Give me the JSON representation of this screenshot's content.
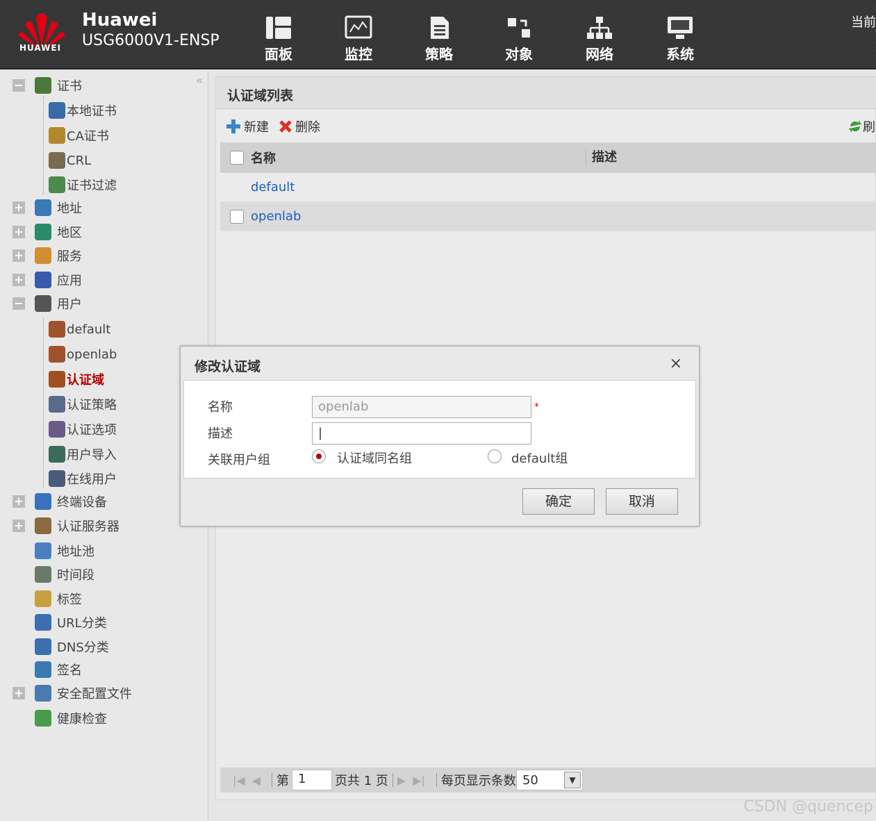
{
  "header": {
    "brand_line1": "Huawei",
    "brand_line2": "USG6000V1-ENSP",
    "logo_text": "HUAWEI",
    "current_label": "当前",
    "nav": [
      {
        "label": "面板",
        "icon": "dashboard-icon"
      },
      {
        "label": "监控",
        "icon": "monitor-icon"
      },
      {
        "label": "策略",
        "icon": "policy-icon"
      },
      {
        "label": "对象",
        "icon": "object-icon"
      },
      {
        "label": "网络",
        "icon": "network-icon"
      },
      {
        "label": "系统",
        "icon": "system-icon"
      }
    ]
  },
  "sidebar": {
    "collapse_icon": "«",
    "items": [
      {
        "label": "证书",
        "expander": "−"
      },
      {
        "label": "本地证书"
      },
      {
        "label": "CA证书"
      },
      {
        "label": "CRL"
      },
      {
        "label": "证书过滤"
      },
      {
        "label": "地址",
        "expander": "+"
      },
      {
        "label": "地区",
        "expander": "+"
      },
      {
        "label": "服务",
        "expander": "+"
      },
      {
        "label": "应用",
        "expander": "+"
      },
      {
        "label": "用户",
        "expander": "−"
      },
      {
        "label": "default"
      },
      {
        "label": "openlab"
      },
      {
        "label": "认证域"
      },
      {
        "label": "认证策略"
      },
      {
        "label": "认证选项"
      },
      {
        "label": "用户导入"
      },
      {
        "label": "在线用户"
      },
      {
        "label": "终端设备",
        "expander": "+"
      },
      {
        "label": "认证服务器",
        "expander": "+"
      },
      {
        "label": "地址池"
      },
      {
        "label": "时间段"
      },
      {
        "label": "标签"
      },
      {
        "label": "URL分类"
      },
      {
        "label": "DNS分类"
      },
      {
        "label": "签名"
      },
      {
        "label": "安全配置文件",
        "expander": "+"
      },
      {
        "label": "健康检查"
      }
    ]
  },
  "main": {
    "title": "认证域列表",
    "toolbar": {
      "new_label": "新建",
      "delete_label": "删除",
      "refresh_label": "刷"
    },
    "grid": {
      "columns": [
        "名称",
        "描述"
      ],
      "rows": [
        {
          "name": "default",
          "desc": ""
        },
        {
          "name": "openlab",
          "desc": ""
        }
      ]
    },
    "pager": {
      "page_prefix": "第",
      "page_value": "1",
      "page_suffix": "页共 1 页",
      "per_page_label": "每页显示条数",
      "per_page_value": "50"
    }
  },
  "dialog": {
    "title": "修改认证域",
    "close": "×",
    "fields": {
      "name_label": "名称",
      "name_value": "openlab",
      "required_mark": "*",
      "desc_label": "描述",
      "desc_value": "|",
      "group_label": "关联用户组",
      "radio_1": "认证域同名组",
      "radio_2": "default组"
    },
    "ok_label": "确定",
    "cancel_label": "取消"
  },
  "watermark": "CSDN @quencep",
  "colors": {
    "active": "#b10000",
    "link": "#1a5fc0"
  }
}
